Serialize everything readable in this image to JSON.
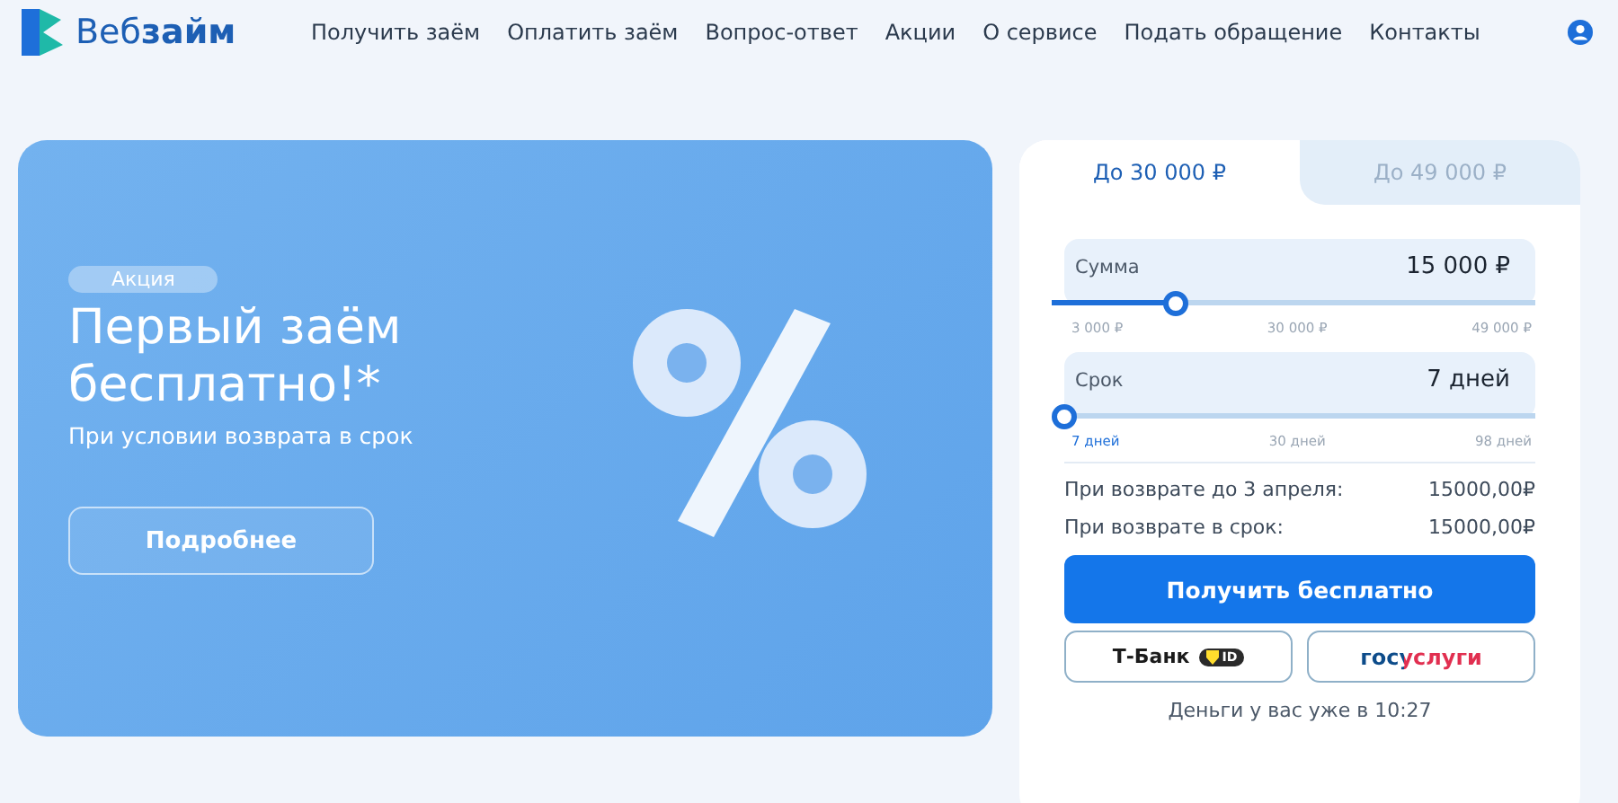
{
  "header": {
    "logo": "Веб**займ**",
    "nav": [
      {
        "label": "Получить заём"
      },
      {
        "label": "Оплатить заём"
      },
      {
        "label": "Вопрос-ответ"
      },
      {
        "label": "Акции"
      },
      {
        "label": "О сервисе"
      },
      {
        "label": "Подать обращение"
      },
      {
        "label": "Контакты"
      }
    ]
  },
  "banner": {
    "badge": "Акция",
    "title": "Первый заём бесплатно!*",
    "subtitle": "При условии возврата в срок",
    "button": "Подробнее"
  },
  "calculator": {
    "tabs": [
      {
        "label": "До 30 000 ₽",
        "selected": true
      },
      {
        "label": "До 49 000 ₽",
        "selected": false
      }
    ],
    "sliders": [
      {
        "label": "Сумма",
        "value": "15 000 ₽",
        "level": 0.235,
        "ticks": [
          "3 000 ₽",
          "30 000 ₽",
          "49 000 ₽"
        ]
      },
      {
        "label": "Срок",
        "value": "7 дней",
        "level": 0,
        "ticks": [
          "7 дней",
          "30 дней",
          "98 дней"
        ]
      }
    ],
    "summary": [
      {
        "label": "При возврате до 3 апреля:",
        "value": "15000,00₽"
      },
      {
        "label": "При возврате в срок:",
        "value": "15000,00₽"
      }
    ],
    "submit": "Получить бесплатно",
    "tbank": {
      "label": "Т-Банк",
      "badge": "ID"
    },
    "gosuslugi": "госуслуги",
    "note": "Деньги у вас уже в 10:27"
  }
}
